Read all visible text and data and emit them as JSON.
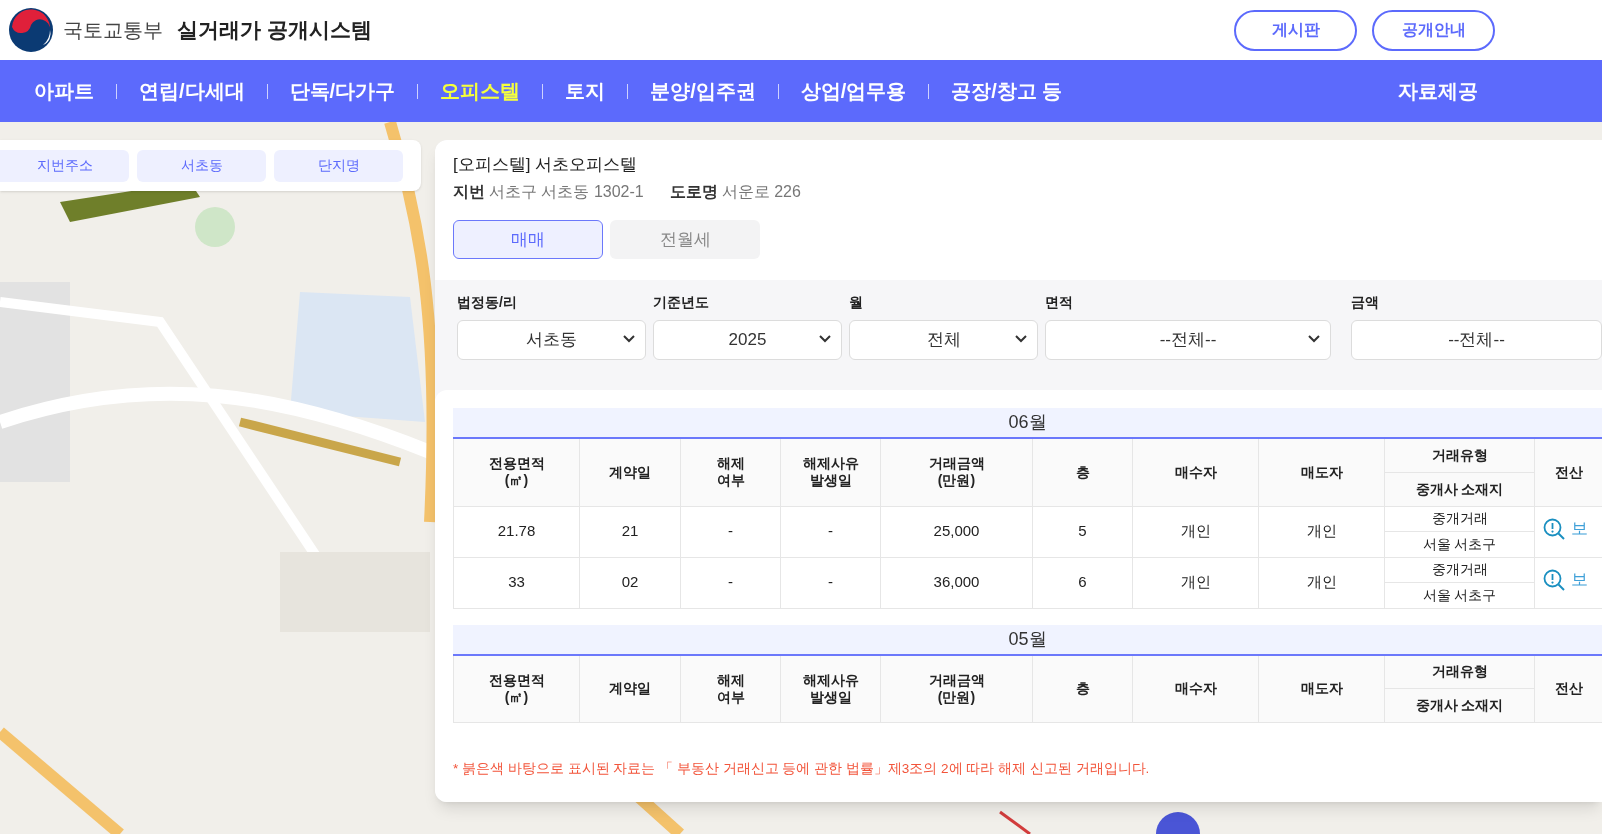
{
  "header": {
    "org": "국토교통부",
    "title": "실거래가 공개시스템",
    "buttons": [
      "게시판",
      "공개안내"
    ]
  },
  "nav": {
    "items": [
      {
        "label": "아파트",
        "selected": false
      },
      {
        "label": "연립/다세대",
        "selected": false
      },
      {
        "label": "단독/다가구",
        "selected": false
      },
      {
        "label": "오피스텔",
        "selected": true
      },
      {
        "label": "토지",
        "selected": false
      },
      {
        "label": "분양/입주권",
        "selected": false
      },
      {
        "label": "상업/업무용",
        "selected": false
      },
      {
        "label": "공장/창고 등",
        "selected": false
      }
    ],
    "extra": "자료제공"
  },
  "map_search": {
    "chips": [
      "지번주소",
      "서초동",
      "단지명"
    ]
  },
  "detail": {
    "title": "[오피스텔] 서초오피스텔",
    "lot_label": "지번",
    "lot": "서초구 서초동 1302-1",
    "road_label": "도로명",
    "road": "서운로 226",
    "tabs": [
      {
        "label": "매매",
        "selected": true
      },
      {
        "label": "전월세",
        "selected": false
      }
    ]
  },
  "filters": [
    {
      "label": "법정동/리",
      "value": "서초동"
    },
    {
      "label": "기준년도",
      "value": "2025"
    },
    {
      "label": "월",
      "value": "전체"
    },
    {
      "label": "면적",
      "value": "--전체--"
    },
    {
      "label": "금액",
      "value": "--전체--"
    }
  ],
  "tables": [
    {
      "month": "06월",
      "columns": [
        "전용면적\n(㎡)",
        "계약일",
        "해제\n여부",
        "해제사유\n발생일",
        "거래금액\n(만원)",
        "층",
        "매수자",
        "매도자"
      ],
      "split_column": [
        "거래유형",
        "중개사 소재지"
      ],
      "last_column": "전산",
      "rows": [
        {
          "cells": [
            "21.78",
            "21",
            "-",
            "-",
            "25,000",
            "5",
            "개인",
            "개인"
          ],
          "deal_type": "중개거래",
          "broker_location": "서울 서초구",
          "link": "보"
        },
        {
          "cells": [
            "33",
            "02",
            "-",
            "-",
            "36,000",
            "6",
            "개인",
            "개인"
          ],
          "deal_type": "중개거래",
          "broker_location": "서울 서초구",
          "link": "보"
        }
      ]
    },
    {
      "month": "05월",
      "columns": [
        "전용면적\n(㎡)",
        "계약일",
        "해제\n여부",
        "해제사유\n발생일",
        "거래금액\n(만원)",
        "층",
        "매수자",
        "매도자"
      ],
      "split_column": [
        "거래유형",
        "중개사 소재지"
      ],
      "last_column": "전산"
    }
  ],
  "footnote": "* 붉은색 바탕으로 표시된 자료는 「 부동산 거래신고 등에 관한 법률」제3조의 2에 따라 해제 신고된 거래입니다."
}
